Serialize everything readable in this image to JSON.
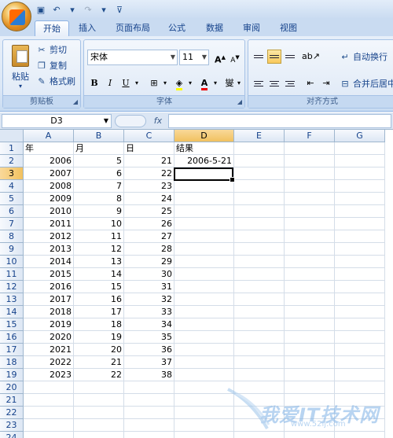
{
  "quick_access": [
    "save-icon",
    "undo-icon",
    "redo-icon",
    "customize-icon"
  ],
  "tabs": [
    {
      "label": "开始",
      "active": true
    },
    {
      "label": "插入",
      "active": false
    },
    {
      "label": "页面布局",
      "active": false
    },
    {
      "label": "公式",
      "active": false
    },
    {
      "label": "数据",
      "active": false
    },
    {
      "label": "审阅",
      "active": false
    },
    {
      "label": "视图",
      "active": false
    }
  ],
  "clipboard": {
    "paste": "粘贴",
    "cut": "剪切",
    "copy": "复制",
    "format_painter": "格式刷",
    "group_label": "剪贴板"
  },
  "font": {
    "name": "宋体",
    "size": "11",
    "grow": "A",
    "shrink": "A",
    "bold": "B",
    "italic": "I",
    "underline": "U",
    "font_color_letter": "A",
    "phonetic": "燮",
    "group_label": "字体"
  },
  "alignment": {
    "wrap_text": "自动换行",
    "merge_center": "合并后居中",
    "group_label": "对齐方式"
  },
  "formula_bar": {
    "name_box": "D3",
    "fx": "fx",
    "content": ""
  },
  "columns": [
    "A",
    "B",
    "C",
    "D",
    "E",
    "F",
    "G"
  ],
  "selected_column": "D",
  "selected_row": "3",
  "rows": [
    {
      "n": "1",
      "A": "年",
      "B": "月",
      "C": "日",
      "D": "结果"
    },
    {
      "n": "2",
      "A": "2006",
      "B": "5",
      "C": "21",
      "D": "2006-5-21"
    },
    {
      "n": "3",
      "A": "2007",
      "B": "6",
      "C": "22",
      "D": ""
    },
    {
      "n": "4",
      "A": "2008",
      "B": "7",
      "C": "23",
      "D": ""
    },
    {
      "n": "5",
      "A": "2009",
      "B": "8",
      "C": "24",
      "D": ""
    },
    {
      "n": "6",
      "A": "2010",
      "B": "9",
      "C": "25",
      "D": ""
    },
    {
      "n": "7",
      "A": "2011",
      "B": "10",
      "C": "26",
      "D": ""
    },
    {
      "n": "8",
      "A": "2012",
      "B": "11",
      "C": "27",
      "D": ""
    },
    {
      "n": "9",
      "A": "2013",
      "B": "12",
      "C": "28",
      "D": ""
    },
    {
      "n": "10",
      "A": "2014",
      "B": "13",
      "C": "29",
      "D": ""
    },
    {
      "n": "11",
      "A": "2015",
      "B": "14",
      "C": "30",
      "D": ""
    },
    {
      "n": "12",
      "A": "2016",
      "B": "15",
      "C": "31",
      "D": ""
    },
    {
      "n": "13",
      "A": "2017",
      "B": "16",
      "C": "32",
      "D": ""
    },
    {
      "n": "14",
      "A": "2018",
      "B": "17",
      "C": "33",
      "D": ""
    },
    {
      "n": "15",
      "A": "2019",
      "B": "18",
      "C": "34",
      "D": ""
    },
    {
      "n": "16",
      "A": "2020",
      "B": "19",
      "C": "35",
      "D": ""
    },
    {
      "n": "17",
      "A": "2021",
      "B": "20",
      "C": "36",
      "D": ""
    },
    {
      "n": "18",
      "A": "2022",
      "B": "21",
      "C": "37",
      "D": ""
    },
    {
      "n": "19",
      "A": "2023",
      "B": "22",
      "C": "38",
      "D": ""
    },
    {
      "n": "20",
      "A": "",
      "B": "",
      "C": "",
      "D": ""
    },
    {
      "n": "21",
      "A": "",
      "B": "",
      "C": "",
      "D": ""
    },
    {
      "n": "22",
      "A": "",
      "B": "",
      "C": "",
      "D": ""
    },
    {
      "n": "23",
      "A": "",
      "B": "",
      "C": "",
      "D": ""
    },
    {
      "n": "24",
      "A": "",
      "B": "",
      "C": "",
      "D": ""
    }
  ],
  "watermark": {
    "text": "我爱IT技术网",
    "url": "www.52ij.com"
  },
  "colors": {
    "accent": "#15428b",
    "selection": "#f1c15f",
    "ribbon": "#dbe7f6"
  }
}
